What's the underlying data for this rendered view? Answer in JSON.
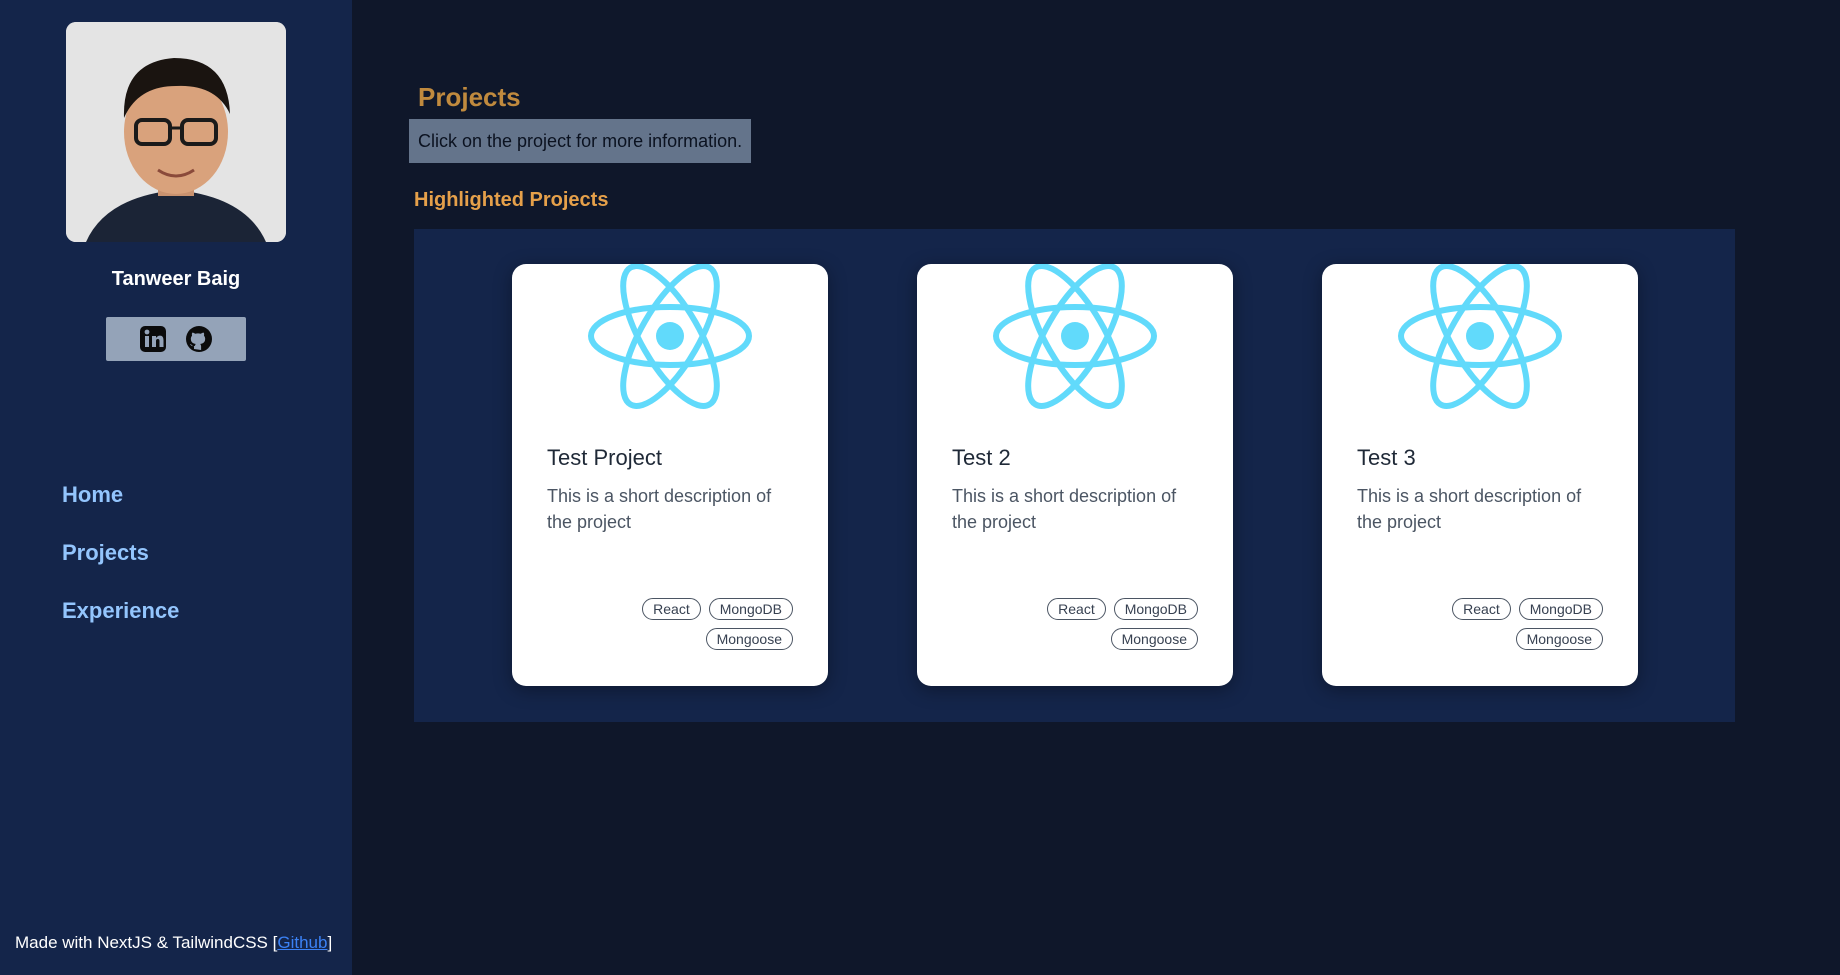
{
  "profile": {
    "name": "Tanweer Baig",
    "avatar_alt": "profile photo"
  },
  "social": {
    "icons": [
      "linkedin-icon",
      "github-icon"
    ]
  },
  "nav": {
    "items": [
      {
        "label": "Home"
      },
      {
        "label": "Projects"
      },
      {
        "label": "Experience"
      }
    ]
  },
  "footer": {
    "text": "Made with NextJS & TailwindCSS [",
    "link": "Github",
    "close": "]"
  },
  "page": {
    "title": "Projects",
    "hint": "Click on the project for more information.",
    "section_title": "Highlighted Projects"
  },
  "projects": [
    {
      "title": "Test Project",
      "description": "This is a short description of the project",
      "tags": [
        "React",
        "MongoDB",
        "Mongoose"
      ],
      "icon": "react-logo-icon"
    },
    {
      "title": "Test 2",
      "description": "This is a short description of the project",
      "tags": [
        "React",
        "MongoDB",
        "Mongoose"
      ],
      "icon": "react-logo-icon"
    },
    {
      "title": "Test 3",
      "description": "This is a short description of the project",
      "tags": [
        "React",
        "MongoDB",
        "Mongoose"
      ],
      "icon": "react-logo-icon"
    }
  ],
  "colors": {
    "background": "#0f172a",
    "sidebar": "#14254a",
    "accent_title": "#c08a3e",
    "section_title": "#e5a04a",
    "nav_link": "#93c5fd",
    "react_blue": "#61dafb"
  }
}
